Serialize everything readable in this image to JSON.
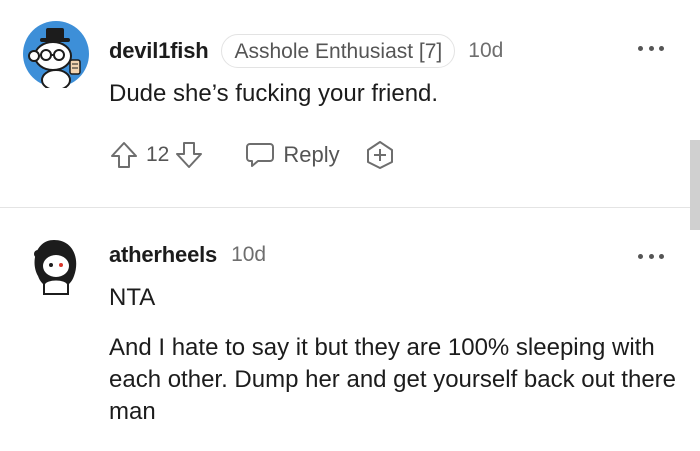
{
  "comments": [
    {
      "username": "devil1fish",
      "flair": "Asshole Enthusiast [7]",
      "time": "10d",
      "body": [
        "Dude she’s fucking your friend."
      ],
      "votes": "12",
      "reply_label": "Reply",
      "avatar_icon": "snoo-avatar-icon"
    },
    {
      "username": "atherheels",
      "time": "10d",
      "body": [
        "NTA",
        "And I hate to say it but they are 100% sleeping with each other. Dump her and get yourself back out there man"
      ],
      "avatar_icon": "snoo-avatar-icon"
    }
  ],
  "colors": {
    "text": "#1c1c1c",
    "muted": "#6e6e6e",
    "avatar_bg": "#3d8fd8",
    "divider": "#e4e4e4"
  }
}
